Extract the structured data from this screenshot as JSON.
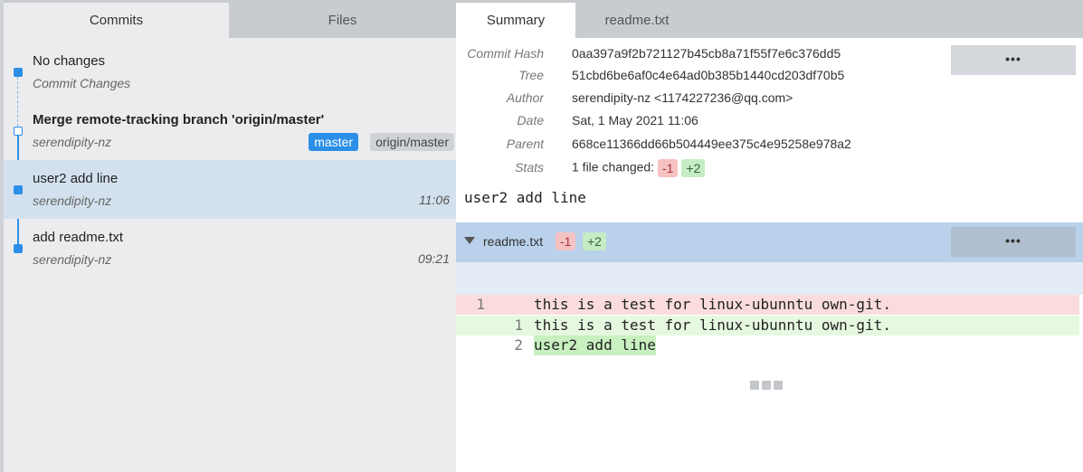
{
  "left_tabs": {
    "commits": "Commits",
    "files": "Files"
  },
  "commits": [
    {
      "subject": "No changes",
      "author": "Commit Changes",
      "time": ""
    },
    {
      "subject": "Merge remote-tracking branch 'origin/master'",
      "author": "serendipity-nz",
      "time": "",
      "badges": [
        "master",
        "origin/master"
      ]
    },
    {
      "subject": "user2 add line",
      "author": "serendipity-nz",
      "time": "11:06"
    },
    {
      "subject": "add readme.txt",
      "author": "serendipity-nz",
      "time": "09:21"
    }
  ],
  "right_tabs": {
    "summary": "Summary",
    "file": "readme.txt"
  },
  "meta": {
    "hash_label": "Commit Hash",
    "hash": "0aa397a9f2b721127b45cb8a71f55f7e6c376dd5",
    "tree_label": "Tree",
    "tree": "51cbd6be6af0c4e64ad0b385b1440cd203df70b5",
    "author_label": "Author",
    "author": "serendipity-nz <1174227236@qq.com>",
    "date_label": "Date",
    "date": "Sat, 1 May 2021 11:06",
    "parent_label": "Parent",
    "parent": "668ce11366dd66b504449ee375c4e95258e978a2",
    "stats_label": "Stats",
    "stats": "1 file changed:",
    "minus": "-1",
    "plus": "+2"
  },
  "more_label": "•••",
  "commit_message": "user2 add line",
  "file": {
    "name": "readme.txt",
    "minus": "-1",
    "plus": "+2"
  },
  "diff": [
    {
      "old": "1",
      "new": "",
      "code": "this is a test for linux-ubunntu own-git.",
      "kind": "del"
    },
    {
      "old": "",
      "new": "1",
      "code": "this is a test for linux-ubunntu own-git.",
      "kind": "add"
    },
    {
      "old": "",
      "new": "2",
      "code": "user2 add line",
      "kind": "add"
    }
  ],
  "colors": {
    "accent": "#2b8fe8",
    "selected_row": "#d3e1ee",
    "file_header": "#b9d1ea"
  }
}
